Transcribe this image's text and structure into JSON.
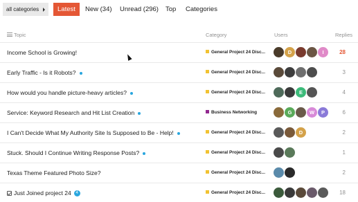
{
  "nav": {
    "category_select": "all categories",
    "tabs": [
      {
        "label": "Latest",
        "active": true
      },
      {
        "label": "New (34)",
        "active": false
      },
      {
        "label": "Unread (296)",
        "active": false
      },
      {
        "label": "Top",
        "active": false
      },
      {
        "label": "Categories",
        "active": false
      }
    ]
  },
  "table": {
    "headers": {
      "topic": "Topic",
      "category": "Category",
      "users": "Users",
      "replies": "Replies"
    },
    "rows": [
      {
        "title": "Income School is Growing!",
        "unread": false,
        "category": "General Project 24 Disc...",
        "category_color": "#f1c232",
        "avatars": [
          {
            "letter": "",
            "color": "#4a3b2a"
          },
          {
            "letter": "D",
            "color": "#d4a24a"
          },
          {
            "letter": "",
            "color": "#7a3b2e"
          },
          {
            "letter": "",
            "color": "#6b5644"
          },
          {
            "letter": "I",
            "color": "#e08ac8"
          }
        ],
        "replies": "28",
        "hot": true
      },
      {
        "title": "Early Traffic - Is it Robots?",
        "unread": true,
        "category": "General Project 24 Disc...",
        "category_color": "#f1c232",
        "avatars": [
          {
            "letter": "",
            "color": "#5a4a3a"
          },
          {
            "letter": "",
            "color": "#3d3d3d"
          },
          {
            "letter": "",
            "color": "#6e6e6e"
          },
          {
            "letter": "",
            "color": "#4d4d4d"
          }
        ],
        "replies": "3",
        "hot": false
      },
      {
        "title": "How would you handle picture-heavy articles?",
        "unread": true,
        "category": "General Project 24 Disc...",
        "category_color": "#f1c232",
        "avatars": [
          {
            "letter": "",
            "color": "#4e6a5a"
          },
          {
            "letter": "",
            "color": "#3b3b3b"
          },
          {
            "letter": "E",
            "color": "#3dbb7a"
          },
          {
            "letter": "",
            "color": "#555555"
          }
        ],
        "replies": "4",
        "hot": false
      },
      {
        "title": "Service: Keyword Research and Hit List Creation",
        "unread": true,
        "category": "Business Networking",
        "category_color": "#92278f",
        "avatars": [
          {
            "letter": "",
            "color": "#8a6a3a"
          },
          {
            "letter": "G",
            "color": "#5aaa5a"
          },
          {
            "letter": "",
            "color": "#6a5a4a"
          },
          {
            "letter": "W",
            "color": "#d88ad8"
          },
          {
            "letter": "P",
            "color": "#8a7ad8"
          }
        ],
        "replies": "6",
        "hot": false
      },
      {
        "title": "I Can't Decide What My Authority Site Is Supposed to Be - Help!",
        "unread": true,
        "category": "General Project 24 Disc...",
        "category_color": "#f1c232",
        "avatars": [
          {
            "letter": "",
            "color": "#5a5a5a"
          },
          {
            "letter": "",
            "color": "#7a5a3a"
          },
          {
            "letter": "D",
            "color": "#d4a24a"
          }
        ],
        "replies": "2",
        "hot": false
      },
      {
        "title": "Stuck. Should I Continue Writing Response Posts?",
        "unread": true,
        "category": "General Project 24 Disc...",
        "category_color": "#f1c232",
        "avatars": [
          {
            "letter": "",
            "color": "#4a4a4a"
          },
          {
            "letter": "",
            "color": "#5a7a5a"
          }
        ],
        "replies": "1",
        "hot": false
      },
      {
        "title": "Texas Theme Featured Photo Size?",
        "unread": false,
        "category": "General Project 24 Disc...",
        "category_color": "#f1c232",
        "avatars": [
          {
            "letter": "",
            "color": "#5a8aaa"
          },
          {
            "letter": "",
            "color": "#2a2a2a"
          }
        ],
        "replies": "2",
        "hot": false
      },
      {
        "title": "Just Joined project 24",
        "unread": false,
        "pinned": true,
        "badge": "4",
        "category": "General Project 24 Disc...",
        "category_color": "#f1c232",
        "avatars": [
          {
            "letter": "",
            "color": "#3b5a3b"
          },
          {
            "letter": "",
            "color": "#3a3a3a"
          },
          {
            "letter": "",
            "color": "#5a4a3a"
          },
          {
            "letter": "",
            "color": "#6a5a6a"
          },
          {
            "letter": "",
            "color": "#5a5a5a"
          }
        ],
        "replies": "18",
        "hot": false
      }
    ]
  }
}
